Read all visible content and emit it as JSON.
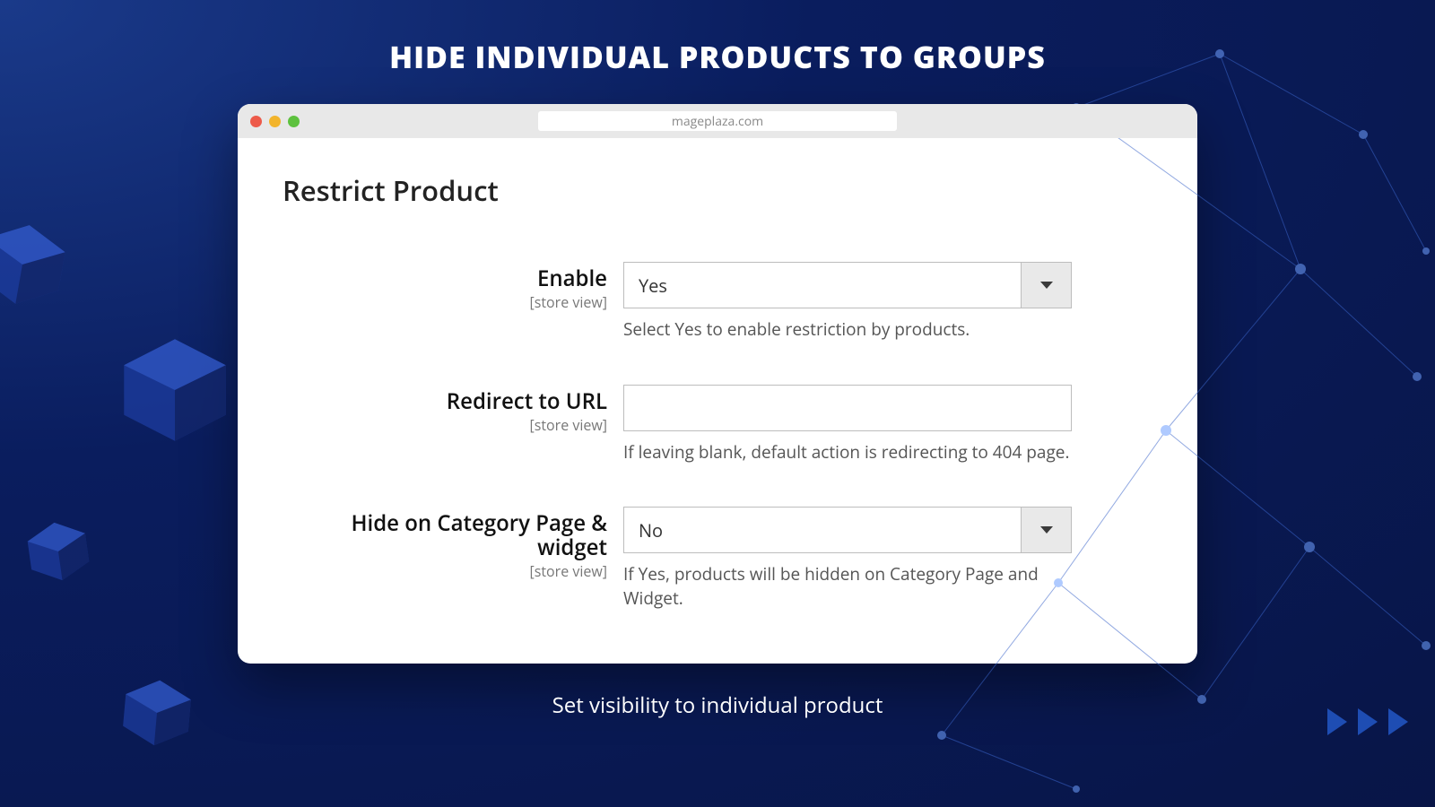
{
  "page": {
    "title": "HIDE INDIVIDUAL PRODUCTS TO GROUPS",
    "caption": "Set visibility to individual product"
  },
  "browser": {
    "url": "mageplaza.com"
  },
  "panel": {
    "section_title": "Restrict Product",
    "fields": {
      "enable": {
        "label": "Enable",
        "scope": "[store view]",
        "value": "Yes",
        "help": "Select Yes to enable restriction by products."
      },
      "redirect": {
        "label": "Redirect to URL",
        "scope": "[store view]",
        "value": "",
        "help": "If leaving blank, default action is redirecting to 404 page."
      },
      "hide": {
        "label": "Hide on Category Page & widget",
        "scope": "[store view]",
        "value": "No",
        "help": "If Yes, products will be hidden on Category Page and Widget."
      }
    }
  }
}
